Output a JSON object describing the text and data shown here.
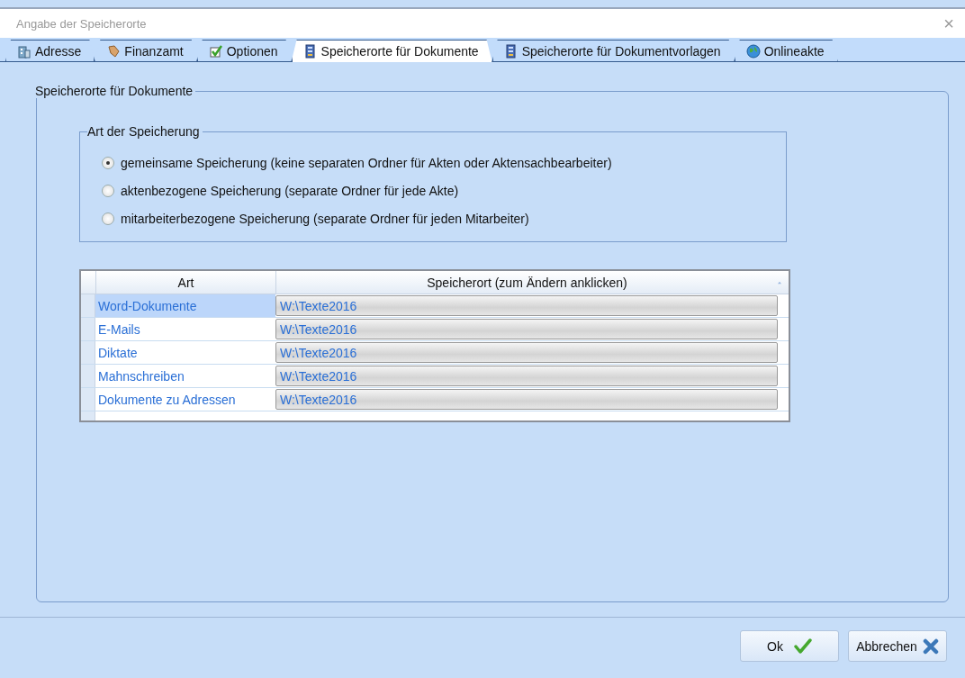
{
  "window": {
    "title": "Angabe der Speicherorte",
    "close": "×"
  },
  "tabs": [
    {
      "label": "Adresse",
      "selected": false
    },
    {
      "label": "Finanzamt",
      "selected": false
    },
    {
      "label": "Optionen",
      "selected": false
    },
    {
      "label": "Speicherorte für Dokumente",
      "selected": true
    },
    {
      "label": "Speicherorte für Dokumentvorlagen",
      "selected": false
    },
    {
      "label": "Onlineakte",
      "selected": false
    }
  ],
  "group": {
    "title": "Speicherorte für Dokumente",
    "storage_type": {
      "title": "Art der Speicherung",
      "options": [
        {
          "label": "gemeinsame Speicherung (keine separaten Ordner für Akten oder Aktensachbearbeiter)",
          "selected": true
        },
        {
          "label": "aktenbezogene Speicherung (separate Ordner für jede Akte)",
          "selected": false
        },
        {
          "label": "mitarbeiterbezogene Speicherung (separate Ordner für jeden Mitarbeiter)",
          "selected": false
        }
      ]
    },
    "table": {
      "columns": [
        "Art",
        "Speicherort (zum Ändern anklicken)"
      ],
      "rows": [
        {
          "art": "Word-Dokumente",
          "location": "W:\\Texte2016",
          "selected": true
        },
        {
          "art": "E-Mails",
          "location": "W:\\Texte2016",
          "selected": false
        },
        {
          "art": "Diktate",
          "location": "W:\\Texte2016",
          "selected": false
        },
        {
          "art": "Mahnschreiben",
          "location": "W:\\Texte2016",
          "selected": false
        },
        {
          "art": "Dokumente zu Adressen",
          "location": "W:\\Texte2016",
          "selected": false
        }
      ]
    }
  },
  "buttons": [
    {
      "label": "Ok",
      "kind": "ok"
    },
    {
      "label": "Abbrechen",
      "kind": "cancel"
    }
  ]
}
